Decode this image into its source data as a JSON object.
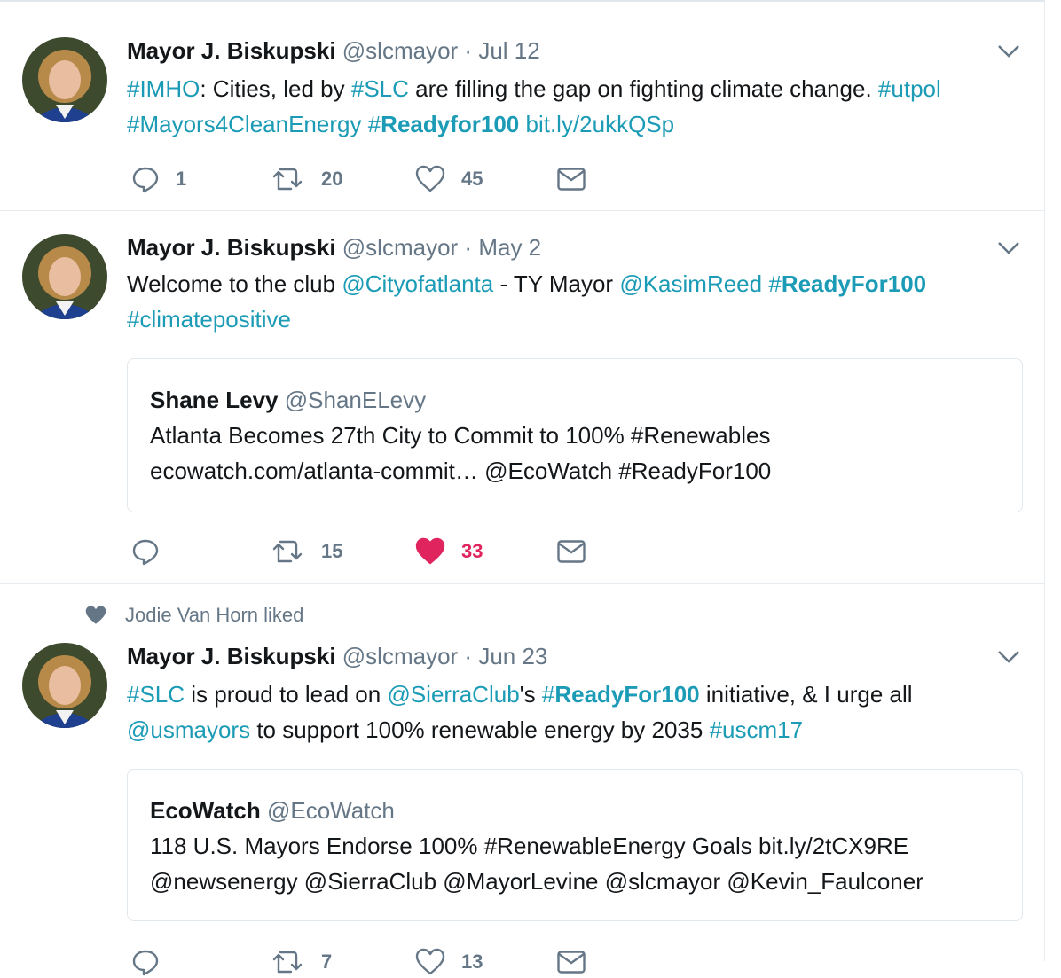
{
  "colors": {
    "link": "#1b9bb5",
    "like_active": "#e0245e",
    "muted": "#657786",
    "border": "#e1e8ed"
  },
  "tweets": [
    {
      "name": "Mayor J. Biskupski",
      "handle": "@slcmayor",
      "dot": "·",
      "date": "Jul 12",
      "text_parts": [
        {
          "t": "#IMHO",
          "link": true
        },
        {
          "t": ": Cities, led by "
        },
        {
          "t": "#SLC",
          "link": true
        },
        {
          "t": " are filling the gap on fighting climate change. "
        },
        {
          "t": "#utpol",
          "link": true
        },
        {
          "t": " "
        },
        {
          "t": "#Mayors4CleanEnergy",
          "link": true
        },
        {
          "t": " "
        },
        {
          "t": "#",
          "link": true
        },
        {
          "t": "Readyfor100",
          "link": true,
          "bold": true
        },
        {
          "t": " "
        },
        {
          "t": "bit.ly/2ukkQSp",
          "link": true
        }
      ],
      "reply_count": "1",
      "retweet_count": "20",
      "like_count": "45",
      "liked": false
    },
    {
      "name": "Mayor J. Biskupski",
      "handle": "@slcmayor",
      "dot": "·",
      "date": "May 2",
      "text_parts": [
        {
          "t": "Welcome to the club "
        },
        {
          "t": "@Cityofatlanta",
          "link": true
        },
        {
          "t": " - TY Mayor "
        },
        {
          "t": "@KasimReed",
          "link": true
        },
        {
          "t": " "
        },
        {
          "t": "#",
          "link": true
        },
        {
          "t": "ReadyFor100",
          "link": true,
          "bold": true
        },
        {
          "t": " "
        },
        {
          "t": "#climatepositive",
          "link": true
        }
      ],
      "quote": {
        "name": "Shane Levy",
        "handle": "@ShanELevy",
        "line1": "Atlanta Becomes 27th City to Commit to 100% #Renewables",
        "line2": "ecowatch.com/atlanta-commit… @EcoWatch #ReadyFor100"
      },
      "reply_count": "",
      "retweet_count": "15",
      "like_count": "33",
      "liked": true
    },
    {
      "social_context": "Jodie Van Horn liked",
      "name": "Mayor J. Biskupski",
      "handle": "@slcmayor",
      "dot": "·",
      "date": "Jun 23",
      "text_parts": [
        {
          "t": "#SLC",
          "link": true
        },
        {
          "t": " is proud to lead on "
        },
        {
          "t": "@SierraClub",
          "link": true
        },
        {
          "t": "'s "
        },
        {
          "t": "#",
          "link": true
        },
        {
          "t": "ReadyFor100",
          "link": true,
          "bold": true
        },
        {
          "t": " initiative, & I urge all "
        },
        {
          "t": "@usmayors",
          "link": true
        },
        {
          "t": " to support 100% renewable energy by 2035 "
        },
        {
          "t": "#uscm17",
          "link": true
        }
      ],
      "quote": {
        "name": "EcoWatch",
        "handle": "@EcoWatch",
        "line1": "118 U.S. Mayors Endorse 100% #RenewableEnergy Goals bit.ly/2tCX9RE",
        "line2": "@newsenergy @SierraClub @MayorLevine @slcmayor @Kevin_Faulconer"
      },
      "reply_count": "",
      "retweet_count": "7",
      "like_count": "13",
      "liked": false
    }
  ]
}
